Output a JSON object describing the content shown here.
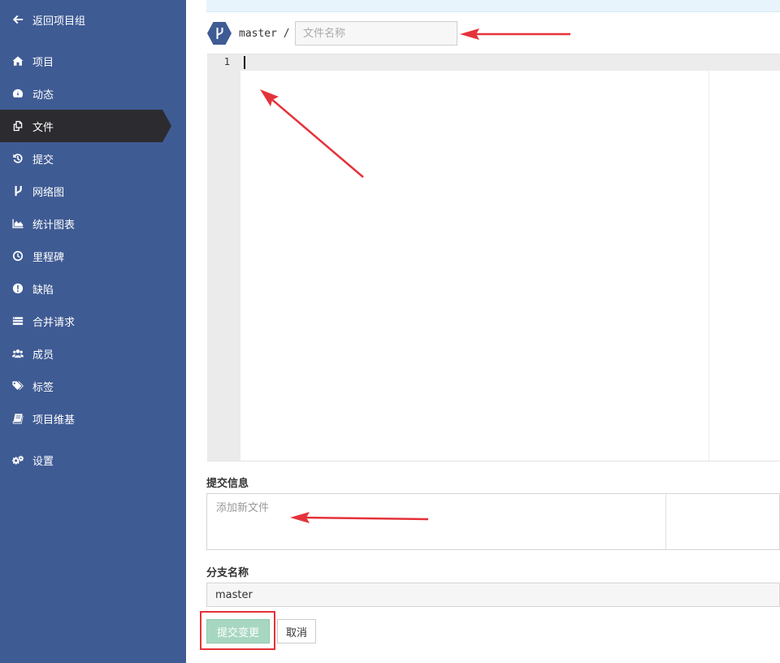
{
  "sidebar": {
    "items": [
      {
        "label": "返回项目组",
        "icon": "arrow-left-icon"
      },
      {
        "label": "项目",
        "icon": "home-icon"
      },
      {
        "label": "动态",
        "icon": "dashboard-icon"
      },
      {
        "label": "文件",
        "icon": "files-icon",
        "active": true
      },
      {
        "label": "提交",
        "icon": "history-icon"
      },
      {
        "label": "网络图",
        "icon": "branch-icon"
      },
      {
        "label": "统计图表",
        "icon": "area-chart-icon"
      },
      {
        "label": "里程碑",
        "icon": "clock-icon"
      },
      {
        "label": "缺陷",
        "icon": "exclamation-icon"
      },
      {
        "label": "合并请求",
        "icon": "list-icon"
      },
      {
        "label": "成员",
        "icon": "users-icon"
      },
      {
        "label": "标签",
        "icon": "tags-icon"
      },
      {
        "label": "项目维基",
        "icon": "book-icon"
      },
      {
        "label": "设置",
        "icon": "cogs-icon"
      }
    ],
    "colors": {
      "background": "#3f5b94",
      "active": "#2c2c30"
    }
  },
  "file_path": {
    "branch": "master",
    "separator": "/",
    "filename_placeholder": "文件名称"
  },
  "editor": {
    "line_numbers": [
      "1"
    ]
  },
  "commit": {
    "label": "提交信息",
    "placeholder": "添加新文件"
  },
  "branch_field": {
    "label": "分支名称",
    "value": "master"
  },
  "buttons": {
    "submit": "提交变更",
    "cancel": "取消"
  },
  "annotation_color": "#e5323a"
}
